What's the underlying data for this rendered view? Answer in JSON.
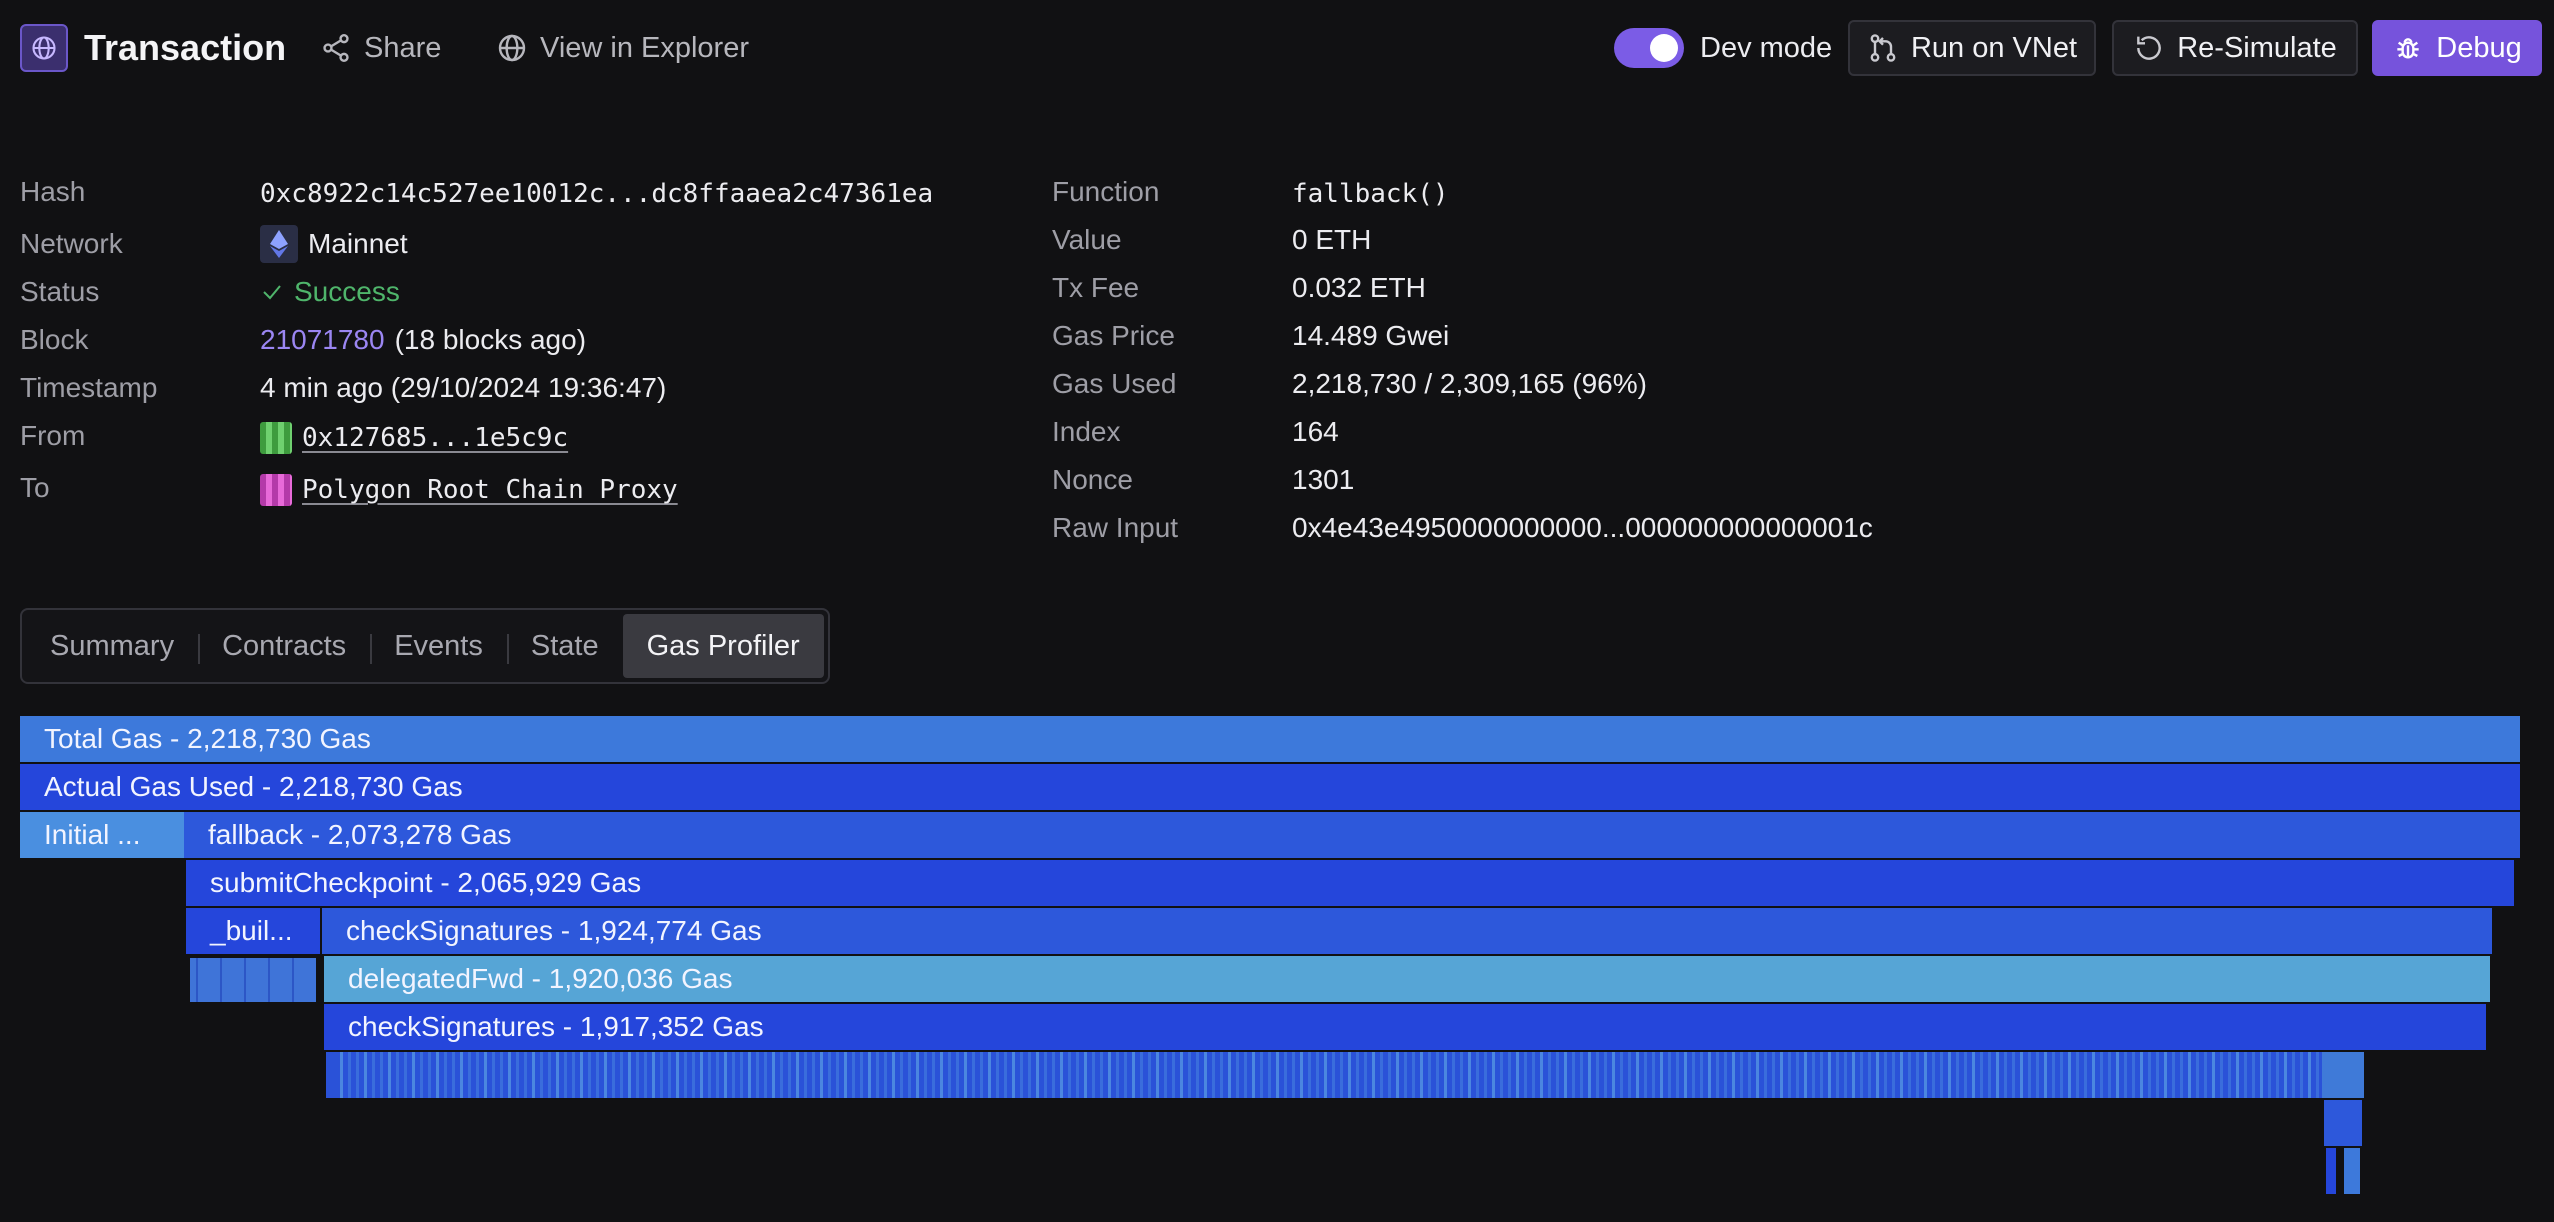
{
  "header": {
    "title": "Transaction",
    "share_label": "Share",
    "explorer_label": "View in Explorer",
    "dev_mode_label": "Dev mode",
    "dev_mode_on": true,
    "run_vnet_label": "Run on VNet",
    "resimulate_label": "Re-Simulate",
    "debug_label": "Debug",
    "accent_color": "#7653dc"
  },
  "details_left": [
    {
      "label": "Hash",
      "value": "0xc8922c14c527ee10012c...dc8ffaaea2c47361ea"
    },
    {
      "label": "Network",
      "value": "Mainnet"
    },
    {
      "label": "Status",
      "value": "Success"
    },
    {
      "label": "Block",
      "value": "21071780",
      "extra": "(18 blocks ago)"
    },
    {
      "label": "Timestamp",
      "value": "4 min ago (29/10/2024 19:36:47)"
    },
    {
      "label": "From",
      "value": "0x127685...1e5c9c"
    },
    {
      "label": "To",
      "value": "Polygon Root Chain Proxy"
    }
  ],
  "details_right": [
    {
      "label": "Function",
      "value": "fallback()"
    },
    {
      "label": "Value",
      "value": "0 ETH"
    },
    {
      "label": "Tx Fee",
      "value": "0.032 ETH"
    },
    {
      "label": "Gas Price",
      "value": "14.489 Gwei"
    },
    {
      "label": "Gas Used",
      "value": "2,218,730 / 2,309,165 (96%)"
    },
    {
      "label": "Index",
      "value": "164"
    },
    {
      "label": "Nonce",
      "value": "1301"
    },
    {
      "label": "Raw Input",
      "value": "0x4e43e4950000000000...000000000000001c"
    }
  ],
  "tabs": [
    {
      "label": "Summary",
      "active": false
    },
    {
      "label": "Contracts",
      "active": false
    },
    {
      "label": "Events",
      "active": false
    },
    {
      "label": "State",
      "active": false
    },
    {
      "label": "Gas Profiler",
      "active": true
    }
  ],
  "gas_profiler": {
    "bars": [
      {
        "label": "Total Gas - 2,218,730 Gas"
      },
      {
        "label": "Actual Gas Used - 2,218,730 Gas"
      },
      {
        "label": "Initial ..."
      },
      {
        "label": "fallback - 2,073,278 Gas"
      },
      {
        "label": "submitCheckpoint - 2,065,929 Gas"
      },
      {
        "label": "_buil..."
      },
      {
        "label": "checkSignatures - 1,924,774 Gas"
      },
      {
        "label": "delegatedFwd - 1,920,036 Gas"
      },
      {
        "label": "checkSignatures - 1,917,352 Gas"
      }
    ]
  }
}
